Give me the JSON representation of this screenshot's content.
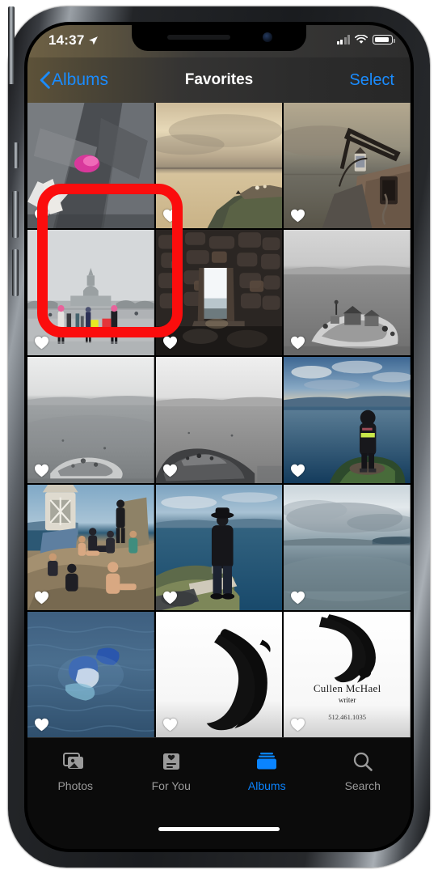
{
  "status_bar": {
    "time": "14:37",
    "location_icon": "location-arrow-icon",
    "signal_icon": "cellular-signal-icon",
    "wifi_icon": "wifi-icon",
    "battery_icon": "battery-icon",
    "battery_level_percent": 78
  },
  "nav_bar": {
    "back_label": "Albums",
    "back_icon": "chevron-left-icon",
    "title": "Favorites",
    "select_label": "Select",
    "accent_color": "#1a8cff"
  },
  "grid": {
    "columns": 3,
    "favorite_icon": "heart-filled-icon",
    "photos": [
      {
        "description": "Crumpled gray tarp fabric with pink flower",
        "favorited": true,
        "highlighted": false
      },
      {
        "description": "Golden sunset over sea with grassy headland",
        "favorited": true,
        "highlighted": false
      },
      {
        "description": "Ruined stone lighthouse building at dusk",
        "favorited": true,
        "highlighted": false
      },
      {
        "description": "US Capitol building with crowd in pink hats",
        "favorited": true,
        "highlighted": true
      },
      {
        "description": "Dark stone ruin interior with bright doorway",
        "favorited": true,
        "highlighted": false
      },
      {
        "description": "Black and white rocky island in calm sea",
        "favorited": true,
        "highlighted": false
      },
      {
        "description": "Pale seascape with distant shoreline",
        "favorited": true,
        "highlighted": false
      },
      {
        "description": "Black and white coastal rocks and sea",
        "favorited": true,
        "highlighted": false
      },
      {
        "description": "Person in dark jacket standing on cliff over blue sea",
        "favorited": true,
        "highlighted": false
      },
      {
        "description": "Group of people sitting by white lighthouse on rocks",
        "favorited": true,
        "highlighted": false
      },
      {
        "description": "Man in hat standing on clifftop facing the sea",
        "favorited": true,
        "highlighted": false
      },
      {
        "description": "Calm gray sea with low clouds and distant island",
        "favorited": true,
        "highlighted": false
      },
      {
        "description": "Blue water with swimmer and reflections",
        "favorited": true,
        "highlighted": false
      },
      {
        "description": "Black crescent brush stroke on white background",
        "favorited": true,
        "highlighted": false
      },
      {
        "description": "Business card with black brush crescent",
        "favorited": true,
        "highlighted": false
      }
    ],
    "business_card": {
      "name": "Cullen McHael",
      "role": "writer",
      "phone": "512.461.1035"
    }
  },
  "tab_bar": {
    "items": [
      {
        "label": "Photos",
        "icon": "photos-icon",
        "active": false
      },
      {
        "label": "For You",
        "icon": "for-you-icon",
        "active": false
      },
      {
        "label": "Albums",
        "icon": "albums-icon",
        "active": true
      },
      {
        "label": "Search",
        "icon": "search-icon",
        "active": false
      }
    ],
    "active_color": "#0a84ff",
    "inactive_color": "#9a9a9a"
  },
  "annotation": {
    "type": "highlight-rectangle",
    "color": "#fb0d0d",
    "target": "US Capitol building photo"
  }
}
